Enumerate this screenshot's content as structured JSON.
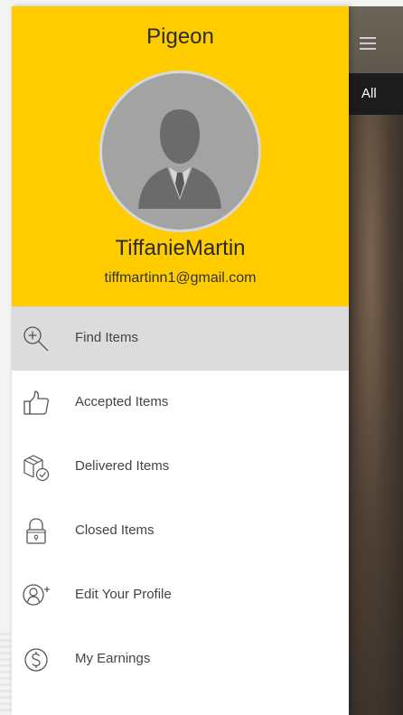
{
  "background_app": {
    "tab_label": "All"
  },
  "drawer": {
    "app_title": "Pigeon",
    "user": {
      "name": "TiffanieMartin",
      "email": "tiffmartinn1@gmail.com"
    },
    "menu_items": [
      {
        "label": "Find Items",
        "icon": "search-plus-icon",
        "active": true
      },
      {
        "label": "Accepted Items",
        "icon": "thumbs-up-icon",
        "active": false
      },
      {
        "label": "Delivered Items",
        "icon": "package-check-icon",
        "active": false
      },
      {
        "label": "Closed Items",
        "icon": "lock-icon",
        "active": false
      },
      {
        "label": "Edit Your Profile",
        "icon": "user-plus-icon",
        "active": false
      },
      {
        "label": "My Earnings",
        "icon": "dollar-circle-icon",
        "active": false
      }
    ]
  },
  "colors": {
    "header": "#ffcc00",
    "active_item": "#dcdcdc",
    "icon_stroke": "#555555"
  }
}
